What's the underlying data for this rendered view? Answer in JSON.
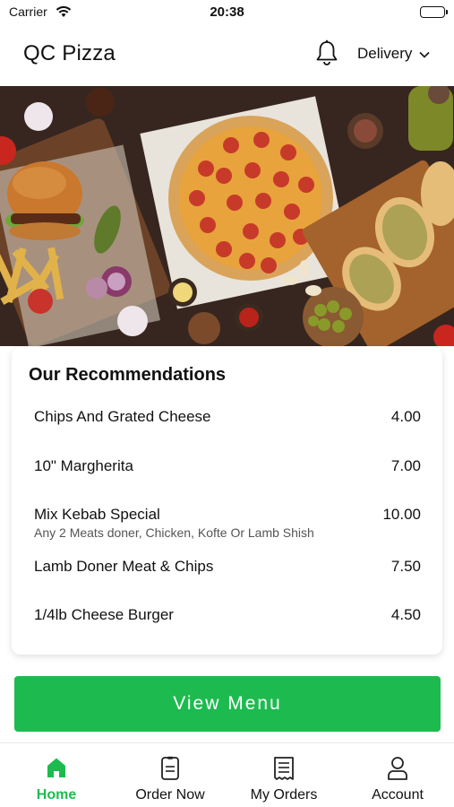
{
  "status_bar": {
    "carrier": "Carrier",
    "time": "20:38"
  },
  "header": {
    "title": "QC Pizza",
    "delivery_label": "Delivery"
  },
  "recommendations": {
    "title": "Our Recommendations",
    "items": [
      {
        "name": "Chips And Grated Cheese",
        "price": "4.00",
        "description": ""
      },
      {
        "name": "10\" Margherita",
        "price": "7.00",
        "description": ""
      },
      {
        "name": "Mix Kebab Special",
        "price": "10.00",
        "description": "Any 2 Meats doner, Chicken, Kofte Or Lamb Shish"
      },
      {
        "name": "Lamb Doner Meat & Chips",
        "price": "7.50",
        "description": ""
      },
      {
        "name": "1/4lb Cheese Burger",
        "price": "4.50",
        "description": ""
      }
    ]
  },
  "view_menu_label": "View Menu",
  "tabs": [
    {
      "label": "Home",
      "icon": "home-icon",
      "active": true
    },
    {
      "label": "Order Now",
      "icon": "order-now-icon",
      "active": false
    },
    {
      "label": "My Orders",
      "icon": "receipt-icon",
      "active": false
    },
    {
      "label": "Account",
      "icon": "user-icon",
      "active": false
    }
  ],
  "colors": {
    "accent": "#1dbb4f",
    "hero_background": "#3d2a22"
  }
}
